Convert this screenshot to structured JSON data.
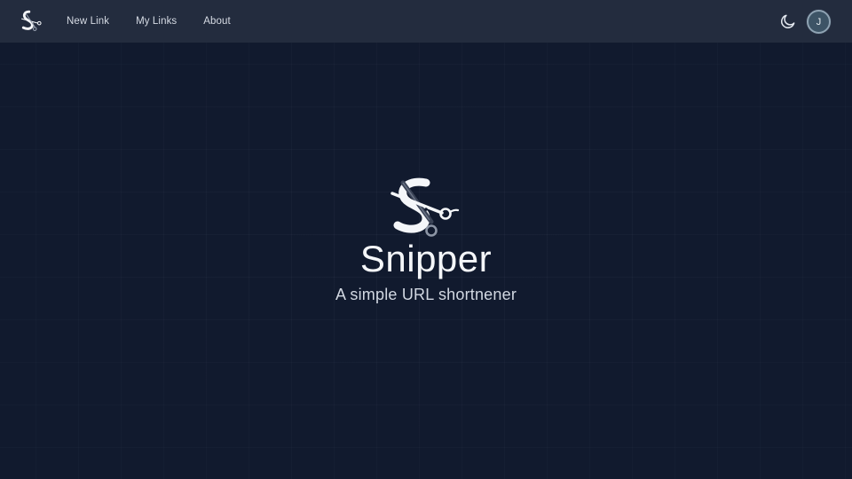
{
  "navbar": {
    "logo_icon": "snipper-scissors-logo-icon",
    "links": [
      {
        "label": "New Link"
      },
      {
        "label": "My Links"
      },
      {
        "label": "About"
      }
    ],
    "theme_toggle_icon": "moon-icon",
    "avatar_initial": "J"
  },
  "hero": {
    "logo_icon": "snipper-scissors-logo-icon",
    "title": "Snipper",
    "subtitle": "A simple URL shortnener"
  },
  "colors": {
    "background": "#111a2e",
    "navbar": "#232c3e",
    "text": "#f4f6f9",
    "avatar": "#3d5466"
  }
}
